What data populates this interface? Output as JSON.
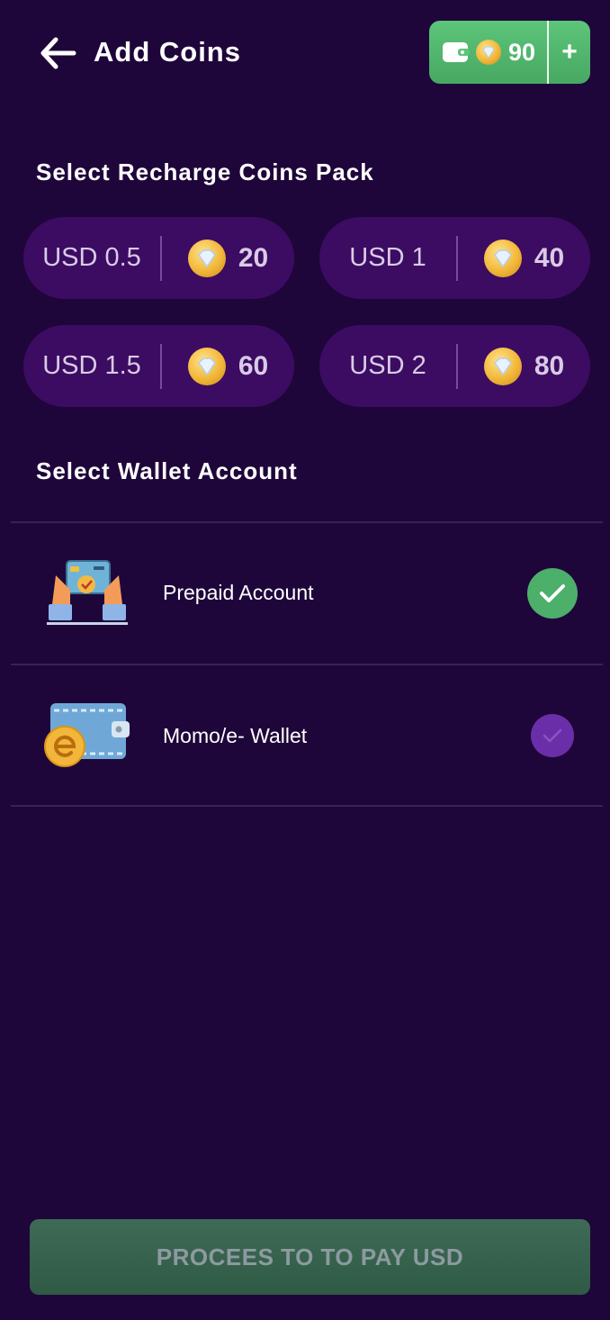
{
  "header": {
    "title": "Add Coins",
    "back_icon": "arrow-left-icon",
    "wallet_balance": "90",
    "wallet_icon": "wallet-icon",
    "add_label": "+"
  },
  "recharge": {
    "section_title": "Select Recharge Coins Pack",
    "packs": [
      {
        "price": "USD 0.5",
        "coins": "20"
      },
      {
        "price": "USD 1",
        "coins": "40"
      },
      {
        "price": "USD 1.5",
        "coins": "60"
      },
      {
        "price": "USD 2",
        "coins": "80"
      }
    ]
  },
  "wallets": {
    "section_title": "Select Wallet Account",
    "accounts": [
      {
        "label": "Prepaid Account",
        "icon": "prepaid-card-icon",
        "selected": true
      },
      {
        "label": "Momo/e- Wallet",
        "icon": "e-wallet-icon",
        "selected": false
      }
    ]
  },
  "proceed_button": {
    "label": "PROCEES TO TO PAY USD"
  },
  "colors": {
    "background": "#1f063a",
    "pack_background": "#3c0b62",
    "accent_green": "#4caf6a",
    "unselected_check": "#6a2fa8"
  }
}
